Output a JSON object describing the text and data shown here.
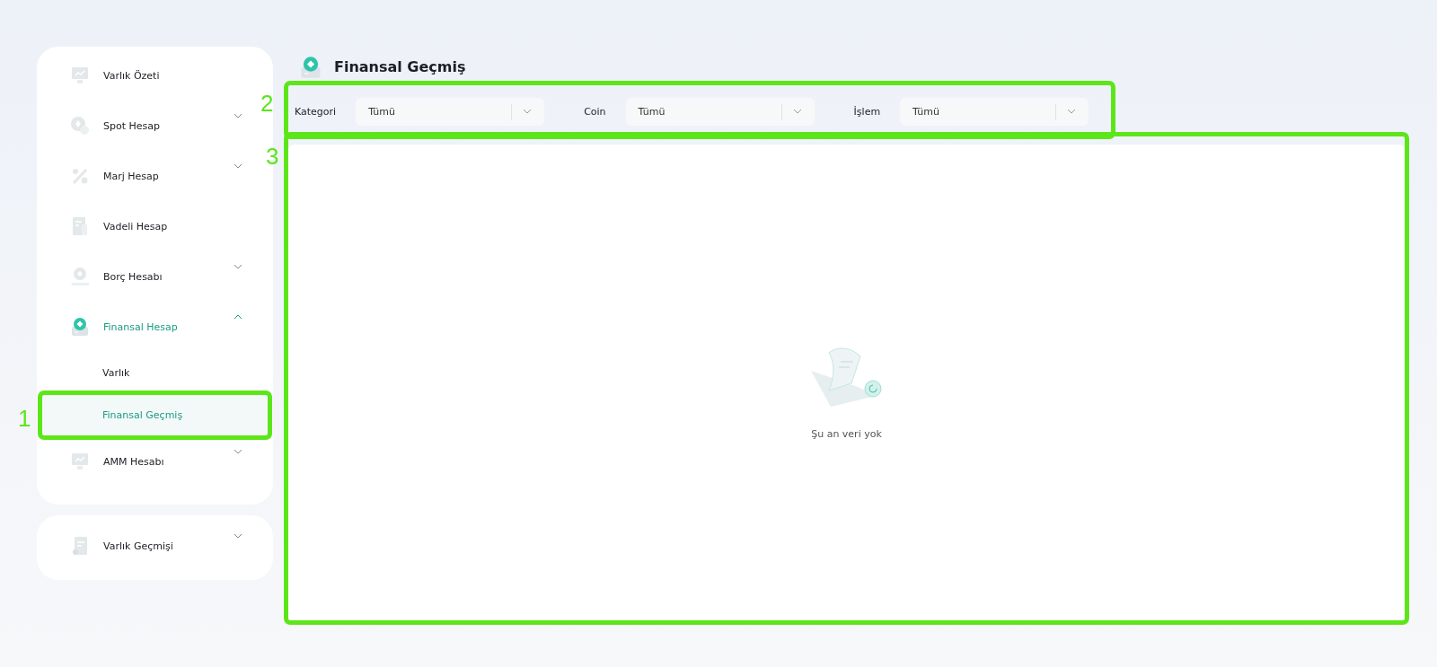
{
  "sidebar": {
    "groups": [
      {
        "items": [
          {
            "label": "Varlık Özeti",
            "expandable": false,
            "current": false
          },
          {
            "label": "Spot Hesap",
            "expandable": true,
            "expanded": false,
            "current": false
          },
          {
            "label": "Marj Hesap",
            "expandable": true,
            "expanded": false,
            "current": false
          },
          {
            "label": "Vadeli Hesap",
            "expandable": false,
            "current": false
          },
          {
            "label": "Borç Hesabı",
            "expandable": true,
            "expanded": false,
            "current": false
          },
          {
            "label": "Finansal Hesap",
            "expandable": true,
            "expanded": true,
            "current": true,
            "children": [
              {
                "label": "Varlık",
                "selected": false
              },
              {
                "label": "Finansal Geçmiş",
                "selected": true,
                "annotation": "1"
              }
            ]
          },
          {
            "label": "AMM Hesabı",
            "expandable": true,
            "expanded": false,
            "current": false
          }
        ]
      },
      {
        "items": [
          {
            "label": "Varlık Geçmişi",
            "expandable": true,
            "expanded": false,
            "current": false
          }
        ]
      }
    ]
  },
  "page": {
    "title": "Finansal Geçmiş"
  },
  "filters": {
    "annotation": "2",
    "fields": [
      {
        "label": "Kategori",
        "value": "Tümü"
      },
      {
        "label": "Coin",
        "value": "Tümü"
      },
      {
        "label": "İşlem",
        "value": "Tümü"
      }
    ]
  },
  "content": {
    "annotation": "3",
    "empty_message": "Şu an veri yok"
  }
}
